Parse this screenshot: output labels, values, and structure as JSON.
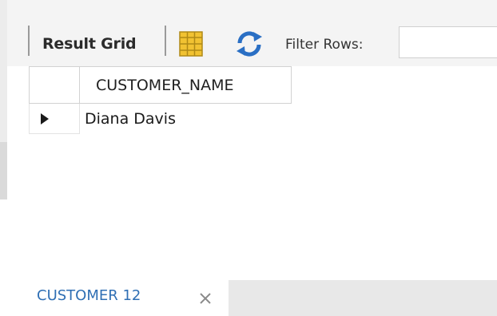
{
  "toolbar": {
    "result_grid_label": "Result Grid",
    "grid_icon": "grid-columns-icon",
    "refresh_icon": "refresh-icon",
    "filter_label": "Filter Rows:",
    "filter_value": ""
  },
  "grid": {
    "columns": [
      "CUSTOMER_NAME"
    ],
    "rows": [
      [
        "Diana Davis"
      ]
    ]
  },
  "tabs": [
    {
      "label": "CUSTOMER 12",
      "active": true
    }
  ],
  "colors": {
    "tab_text": "#2f6fb4",
    "refresh_blue": "#2a6fc4",
    "grid_icon_yellow": "#f1c232",
    "toolbar_bg": "#f4f4f4"
  }
}
